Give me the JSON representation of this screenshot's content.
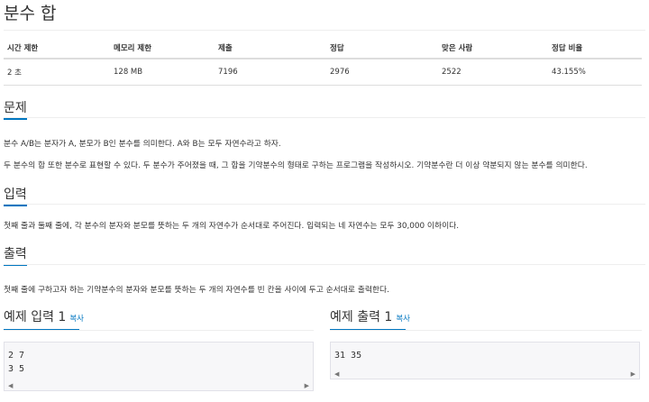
{
  "problem": {
    "title": "분수 합"
  },
  "info": {
    "headers": [
      "시간 제한",
      "메모리 제한",
      "제출",
      "정답",
      "맞은 사람",
      "정답 비율"
    ],
    "values": [
      "2 초",
      "128 MB",
      "7196",
      "2976",
      "2522",
      "43.155%"
    ]
  },
  "description": {
    "heading": "문제",
    "lines": [
      "분수 A/B는 분자가 A, 분모가 B인 분수를 의미한다. A와 B는 모두 자연수라고 하자.",
      "두 분수의 합 또한 분수로 표현할 수 있다. 두 분수가 주어졌을 때, 그 합을 기약분수의 형태로 구하는 프로그램을 작성하시오. 기약분수란 더 이상 약분되지 않는 분수를 의미한다."
    ]
  },
  "input": {
    "heading": "입력",
    "text": "첫째 줄과 둘째 줄에, 각 분수의 분자와 분모를 뜻하는 두 개의 자연수가 순서대로 주어진다. 입력되는 네 자연수는 모두 30,000 이하이다."
  },
  "output": {
    "heading": "출력",
    "text": "첫째 줄에 구하고자 하는 기약분수의 분자와 분모를 뜻하는 두 개의 자연수를 빈 칸을 사이에 두고 순서대로 출력한다."
  },
  "sample_input": {
    "heading": "예제 입력 1",
    "copy_label": "복사",
    "content": "2 7\n3 5"
  },
  "sample_output": {
    "heading": "예제 출력 1",
    "copy_label": "복사",
    "content": "31 35"
  },
  "icons": {
    "scroll_left": "triangle-left-icon",
    "scroll_right": "triangle-right-icon"
  },
  "colors": {
    "accent": "#0076c0",
    "sample_bg": "#f7f7f9",
    "sample_border": "#e1e1e8"
  }
}
